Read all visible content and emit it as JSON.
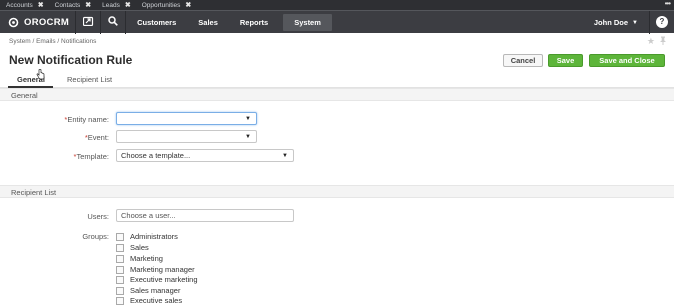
{
  "pinned_tabs": [
    {
      "label": "Accounts"
    },
    {
      "label": "Contacts"
    },
    {
      "label": "Leads"
    },
    {
      "label": "Opportunities"
    }
  ],
  "nav": {
    "brand": "OROCRM",
    "items": [
      {
        "label": "Customers"
      },
      {
        "label": "Sales"
      },
      {
        "label": "Reports"
      },
      {
        "label": "System"
      }
    ],
    "user": "John Doe",
    "help": "?"
  },
  "breadcrumb": "System / Emails / Notifications",
  "page_title": "New Notification Rule",
  "buttons": {
    "cancel": "Cancel",
    "save": "Save",
    "save_close": "Save and Close"
  },
  "tabs": [
    {
      "label": "General"
    },
    {
      "label": "Recipient List"
    }
  ],
  "general": {
    "heading": "General",
    "fields": {
      "entity_name": {
        "label": "Entity name:",
        "value": ""
      },
      "event": {
        "label": "Event:",
        "value": ""
      },
      "template": {
        "label": "Template:",
        "placeholder": "Choose a template..."
      }
    }
  },
  "recipient_list": {
    "heading": "Recipient List",
    "users": {
      "label": "Users:",
      "placeholder": "Choose a user..."
    },
    "groups_label": "Groups:",
    "groups": [
      {
        "label": "Administrators",
        "checked": false
      },
      {
        "label": "Sales",
        "checked": false
      },
      {
        "label": "Marketing",
        "checked": false
      },
      {
        "label": "Marketing manager",
        "checked": false
      },
      {
        "label": "Executive marketing",
        "checked": false
      },
      {
        "label": "Sales manager",
        "checked": false
      },
      {
        "label": "Executive sales",
        "checked": false
      }
    ]
  },
  "colors": {
    "nav_bg": "#3c3d42",
    "pinbar_bg": "#2e2f33",
    "primary_button": "#5db53a",
    "required": "#c83a2e"
  }
}
